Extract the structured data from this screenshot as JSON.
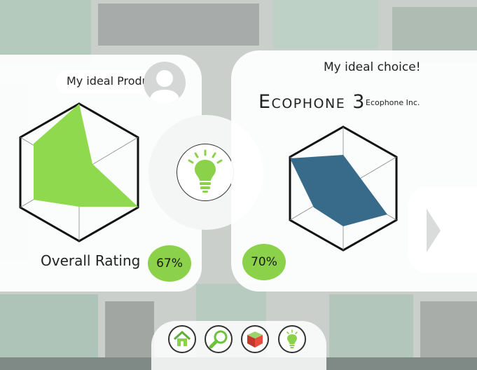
{
  "left_panel": {
    "title": "My ideal Product",
    "rating_label": "Overall Rating",
    "rating_value": "67%",
    "radar_color": "#8fd94f"
  },
  "right_panel": {
    "title": "My ideal choice!",
    "product_name": "Ecophone 3",
    "manufacturer": "Ecophone Inc.",
    "rating_value": "70%",
    "radar_color": "#386b8a"
  },
  "colors": {
    "accent_green": "#8bd14a",
    "accent_blue": "#386b8a"
  },
  "icons": {
    "center": "lightbulb-icon",
    "avatar": "user-avatar-icon",
    "next": "chevron-right-icon",
    "nav": [
      "home-icon",
      "search-icon",
      "box-icon",
      "lightbulb-icon"
    ]
  }
}
